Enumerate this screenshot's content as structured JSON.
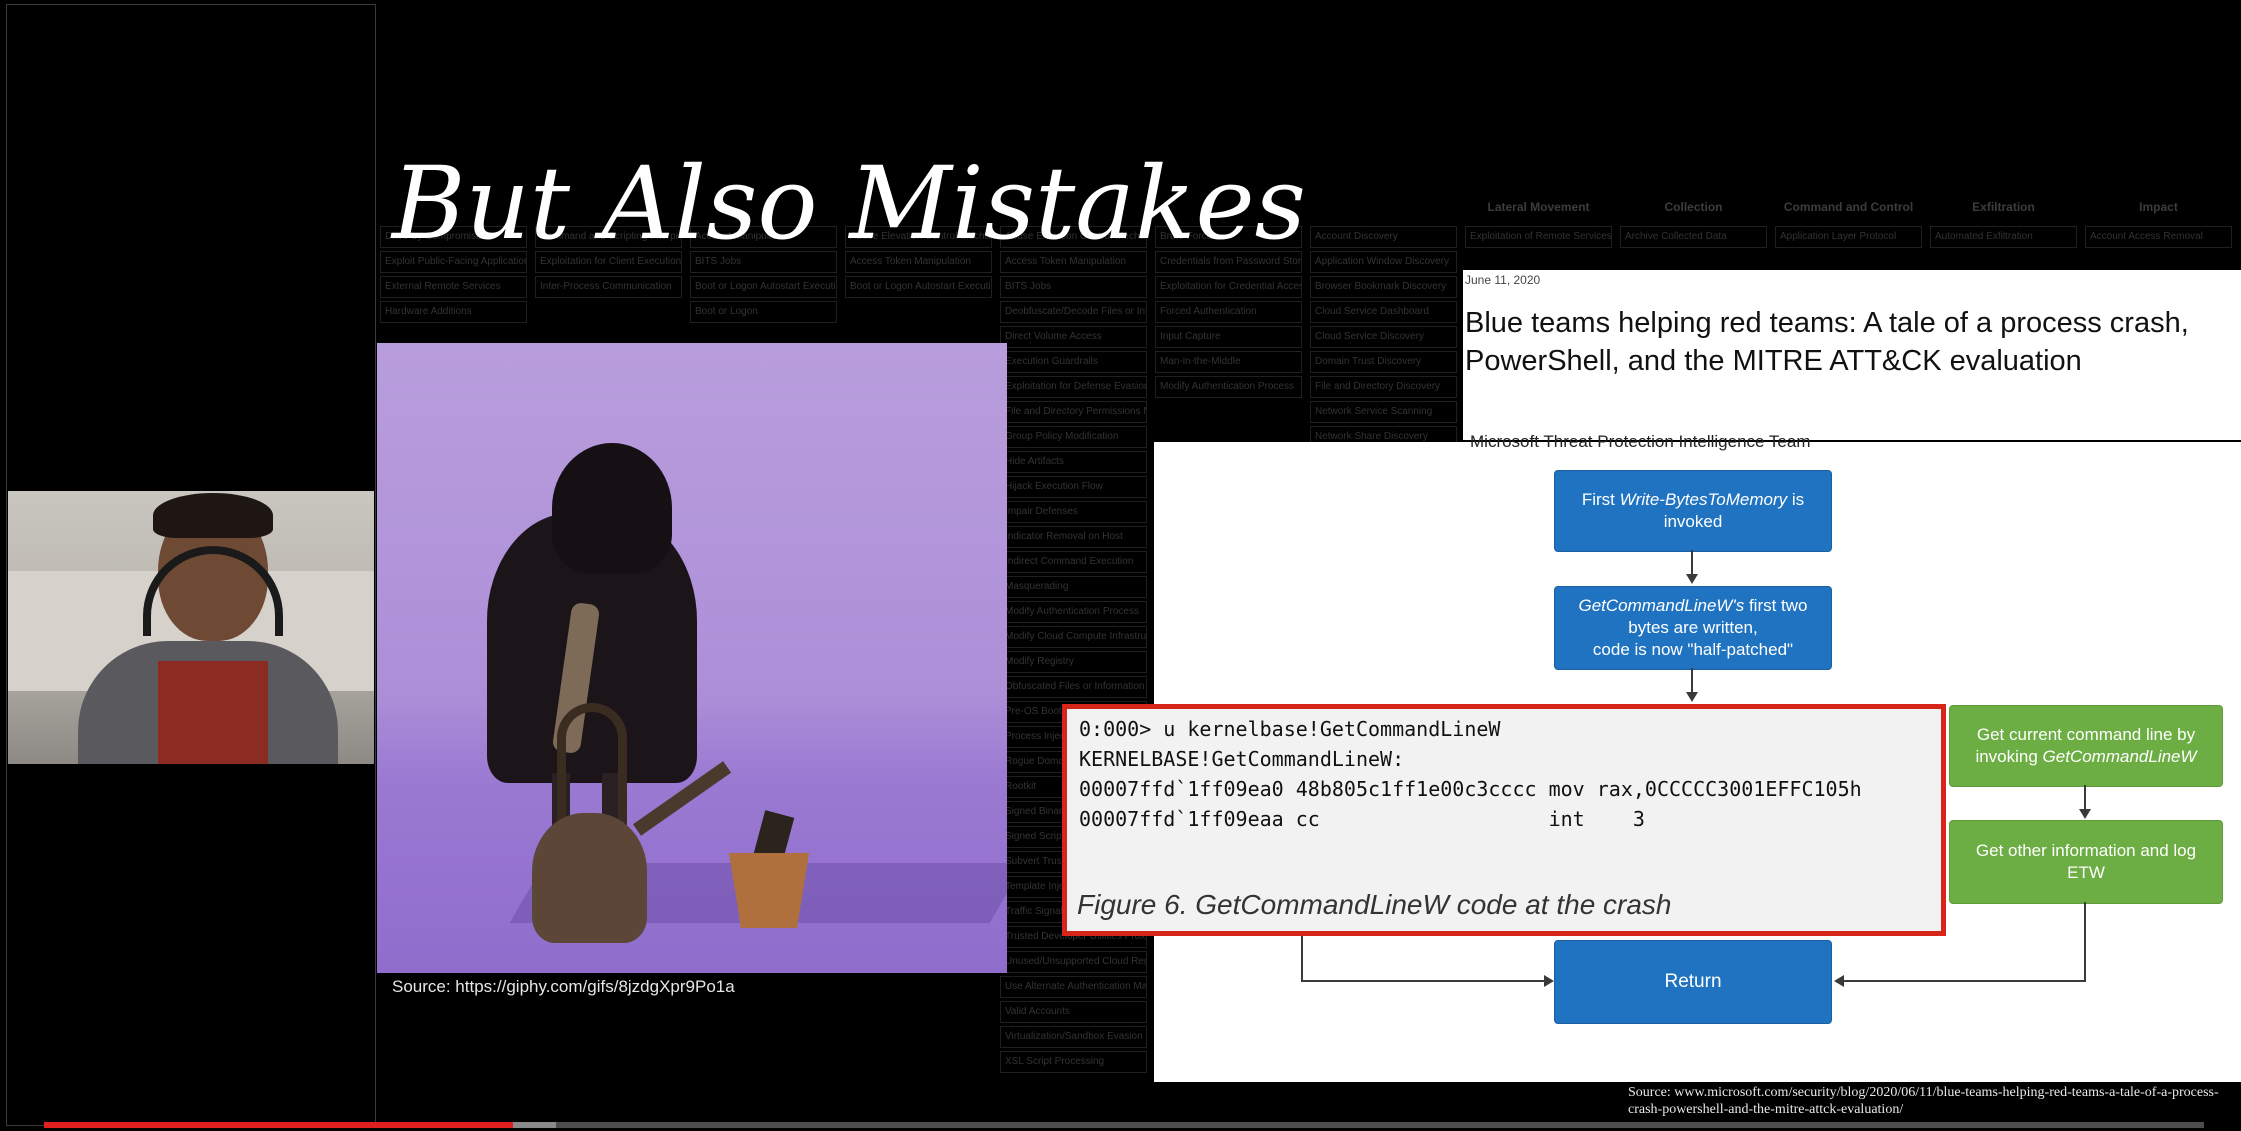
{
  "slide": {
    "title": "But Also Mistakes"
  },
  "gif": {
    "source": "Source: https://giphy.com/gifs/8jzdgXpr9Po1a"
  },
  "attack_matrix": {
    "columns": [
      {
        "name": "",
        "cells": [
          "Drive-by Compromise",
          "Exploit Public-Facing Application",
          "External Remote Services",
          "Hardware Additions"
        ]
      },
      {
        "name": "",
        "cells": [
          "Command and Scripting Interpreter",
          "Exploitation for Client Execution",
          "Inter-Process Communication"
        ]
      },
      {
        "name": "",
        "cells": [
          "Account Manipulation",
          "BITS Jobs",
          "Boot or Logon Autostart Execution",
          "Boot or Logon"
        ]
      },
      {
        "name": "",
        "cells": [
          "Abuse Elevation Control Mechanism",
          "Access Token Manipulation",
          "Boot or Logon Autostart Execution"
        ]
      },
      {
        "name": "",
        "cells": [
          "Abuse Elevation Control Mechanism",
          "Access Token Manipulation",
          "BITS Jobs",
          "Deobfuscate/Decode Files or Information",
          "Direct Volume Access",
          "Execution Guardrails",
          "Exploitation for Defense Evasion",
          "File and Directory Permissions Modification",
          "Group Policy Modification",
          "Hide Artifacts",
          "Hijack Execution Flow",
          "Impair Defenses",
          "Indicator Removal on Host",
          "Indirect Command Execution",
          "Masquerading",
          "Modify Authentication Process",
          "Modify Cloud Compute Infrastructure",
          "Modify Registry",
          "Obfuscated Files or Information",
          "Pre-OS Boot",
          "Process Injection",
          "Rogue Domain Controller",
          "Rootkit",
          "Signed Binary Proxy Execution",
          "Signed Script Proxy Execution",
          "Subvert Trust Controls",
          "Template Injection",
          "Traffic Signaling",
          "Trusted Developer Utilities Proxy Execution",
          "Unused/Unsupported Cloud Regions",
          "Use Alternate Authentication Material",
          "Valid Accounts",
          "Virtualization/Sandbox Evasion",
          "XSL Script Processing"
        ]
      },
      {
        "name": "",
        "cells": [
          "Brute Force",
          "Credentials from Password Stores",
          "Exploitation for Credential Access",
          "Forced Authentication",
          "Input Capture",
          "Man-in-the-Middle",
          "Modify Authentication Process"
        ]
      },
      {
        "name": "",
        "cells": [
          "Account Discovery",
          "Application Window Discovery",
          "Browser Bookmark Discovery",
          "Cloud Service Dashboard",
          "Cloud Service Discovery",
          "Domain Trust Discovery",
          "File and Directory Discovery",
          "Network Service Scanning",
          "Network Share Discovery"
        ]
      },
      {
        "name": "Lateral Movement",
        "cells": [
          "Exploitation of Remote Services"
        ]
      },
      {
        "name": "Collection",
        "cells": [
          "Archive Collected Data"
        ]
      },
      {
        "name": "Command and Control",
        "cells": [
          "Application Layer Protocol"
        ]
      },
      {
        "name": "Exfiltration",
        "cells": [
          "Automated Exfiltration"
        ]
      },
      {
        "name": "Impact",
        "cells": [
          "Account Access Removal"
        ]
      }
    ]
  },
  "blog": {
    "date": "June 11, 2020",
    "title": "Blue teams helping red teams: A tale of a process crash, PowerShell, and the MITRE ATT&CK evaluation",
    "author": "Microsoft Threat Protection Intelligence Team"
  },
  "diagram": {
    "step1_prefix": "First ",
    "step1_em": "Write-BytesToMemory",
    "step1_suffix": " is invoked",
    "step2_em": "GetCommandLineW's",
    "step2_rest": " first two bytes are written,",
    "step2_line3": "code is now \"half-patched\"",
    "step3_prefix": "Get current command line by invoking ",
    "step3_em": "GetCommandLineW",
    "step4": "Get other information and log ETW",
    "return": "Return"
  },
  "figure6": {
    "lines": [
      "0:000> u kernelbase!GetCommandLineW",
      "KERNELBASE!GetCommandLineW:",
      "00007ffd`1ff09ea0 48b805c1ff1e00c3cccc mov rax,0CCCCC3001EFFC105h",
      "00007ffd`1ff09eaa cc                   int    3"
    ],
    "caption": "Figure 6. GetCommandLineW code at the crash"
  },
  "ms_source": "Source: www.microsoft.com/security/blog/2020/06/11/blue-teams-helping-red-teams-a-tale-of-a-process-crash-powershell-and-the-mitre-attck-evaluation/",
  "video": {
    "played_fraction": 0.217,
    "buffered_fraction": 0.237
  },
  "colors": {
    "accent_red": "#d7251c",
    "flow_blue": "#1f73c1",
    "flow_green": "#6dae44",
    "progress_red": "#e01f1f"
  }
}
